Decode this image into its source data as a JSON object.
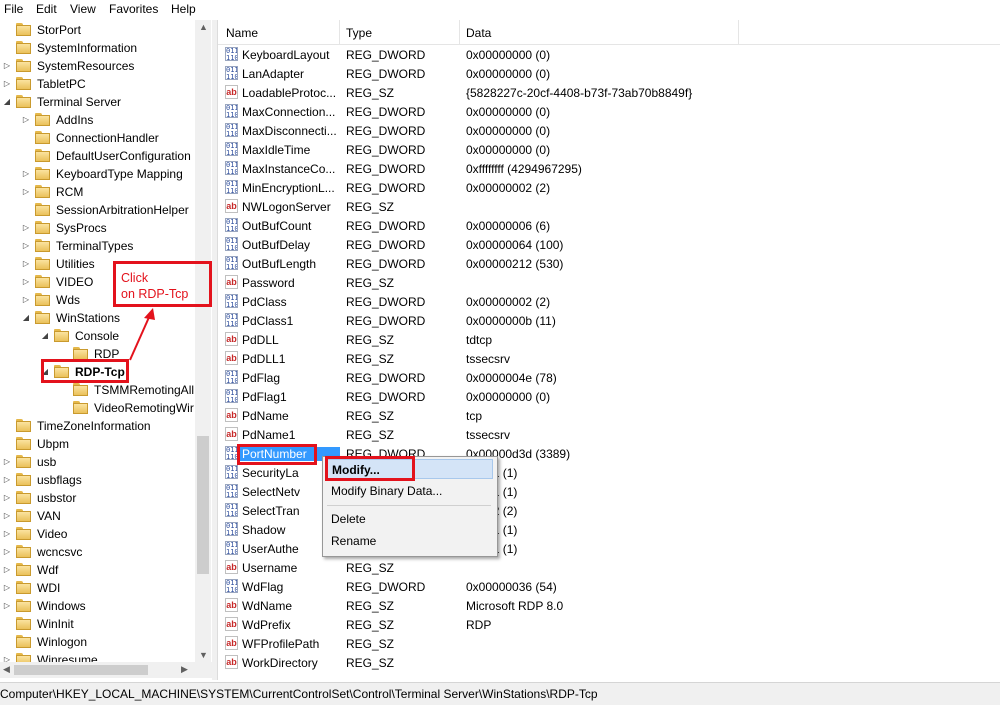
{
  "menubar": {
    "items": [
      "File",
      "Edit",
      "View",
      "Favorites",
      "Help"
    ]
  },
  "tree": {
    "items": [
      {
        "label": "StorPort"
      },
      {
        "label": "SystemInformation"
      },
      {
        "label": "SystemResources"
      },
      {
        "label": "TabletPC"
      },
      {
        "label": "Terminal Server"
      },
      {
        "label": "AddIns"
      },
      {
        "label": "ConnectionHandler"
      },
      {
        "label": "DefaultUserConfiguration"
      },
      {
        "label": "KeyboardType Mapping"
      },
      {
        "label": "RCM"
      },
      {
        "label": "SessionArbitrationHelper"
      },
      {
        "label": "SysProcs"
      },
      {
        "label": "TerminalTypes"
      },
      {
        "label": "Utilities"
      },
      {
        "label": "VIDEO"
      },
      {
        "label": "Wds"
      },
      {
        "label": "WinStations"
      },
      {
        "label": "Console"
      },
      {
        "label": "RDP"
      },
      {
        "label": "RDP-Tcp"
      },
      {
        "label": "TSMMRemotingAll"
      },
      {
        "label": "VideoRemotingWir"
      },
      {
        "label": "TimeZoneInformation"
      },
      {
        "label": "Ubpm"
      },
      {
        "label": "usb"
      },
      {
        "label": "usbflags"
      },
      {
        "label": "usbstor"
      },
      {
        "label": "VAN"
      },
      {
        "label": "Video"
      },
      {
        "label": "wcncsvc"
      },
      {
        "label": "Wdf"
      },
      {
        "label": "WDI"
      },
      {
        "label": "Windows"
      },
      {
        "label": "WinInit"
      },
      {
        "label": "Winlogon"
      },
      {
        "label": "Winresume"
      }
    ]
  },
  "columns": {
    "name": "Name",
    "type": "Type",
    "data": "Data"
  },
  "values": [
    {
      "icon": "dword",
      "name": "KeyboardLayout",
      "type": "REG_DWORD",
      "data": "0x00000000 (0)"
    },
    {
      "icon": "dword",
      "name": "LanAdapter",
      "type": "REG_DWORD",
      "data": "0x00000000 (0)"
    },
    {
      "icon": "sz",
      "name": "LoadableProtoc...",
      "type": "REG_SZ",
      "data": "{5828227c-20cf-4408-b73f-73ab70b8849f}"
    },
    {
      "icon": "dword",
      "name": "MaxConnection...",
      "type": "REG_DWORD",
      "data": "0x00000000 (0)"
    },
    {
      "icon": "dword",
      "name": "MaxDisconnecti...",
      "type": "REG_DWORD",
      "data": "0x00000000 (0)"
    },
    {
      "icon": "dword",
      "name": "MaxIdleTime",
      "type": "REG_DWORD",
      "data": "0x00000000 (0)"
    },
    {
      "icon": "dword",
      "name": "MaxInstanceCo...",
      "type": "REG_DWORD",
      "data": "0xffffffff (4294967295)"
    },
    {
      "icon": "dword",
      "name": "MinEncryptionL...",
      "type": "REG_DWORD",
      "data": "0x00000002 (2)"
    },
    {
      "icon": "sz",
      "name": "NWLogonServer",
      "type": "REG_SZ",
      "data": ""
    },
    {
      "icon": "dword",
      "name": "OutBufCount",
      "type": "REG_DWORD",
      "data": "0x00000006 (6)"
    },
    {
      "icon": "dword",
      "name": "OutBufDelay",
      "type": "REG_DWORD",
      "data": "0x00000064 (100)"
    },
    {
      "icon": "dword",
      "name": "OutBufLength",
      "type": "REG_DWORD",
      "data": "0x00000212 (530)"
    },
    {
      "icon": "sz",
      "name": "Password",
      "type": "REG_SZ",
      "data": ""
    },
    {
      "icon": "dword",
      "name": "PdClass",
      "type": "REG_DWORD",
      "data": "0x00000002 (2)"
    },
    {
      "icon": "dword",
      "name": "PdClass1",
      "type": "REG_DWORD",
      "data": "0x0000000b (11)"
    },
    {
      "icon": "sz",
      "name": "PdDLL",
      "type": "REG_SZ",
      "data": "tdtcp"
    },
    {
      "icon": "sz",
      "name": "PdDLL1",
      "type": "REG_SZ",
      "data": "tssecsrv"
    },
    {
      "icon": "dword",
      "name": "PdFlag",
      "type": "REG_DWORD",
      "data": "0x0000004e (78)"
    },
    {
      "icon": "dword",
      "name": "PdFlag1",
      "type": "REG_DWORD",
      "data": "0x00000000 (0)"
    },
    {
      "icon": "sz",
      "name": "PdName",
      "type": "REG_SZ",
      "data": "tcp"
    },
    {
      "icon": "sz",
      "name": "PdName1",
      "type": "REG_SZ",
      "data": "tssecsrv"
    },
    {
      "icon": "dword",
      "name": "PortNumber",
      "type": "REG_DWORD",
      "data": "0x00000d3d (3389)",
      "selected": true
    },
    {
      "icon": "dword",
      "name": "SecurityLa",
      "type": "",
      "data": "00001 (1)"
    },
    {
      "icon": "dword",
      "name": "SelectNetv",
      "type": "",
      "data": "00001 (1)"
    },
    {
      "icon": "dword",
      "name": "SelectTran",
      "type": "",
      "data": "00002 (2)"
    },
    {
      "icon": "dword",
      "name": "Shadow",
      "type": "",
      "data": "00001 (1)"
    },
    {
      "icon": "dword",
      "name": "UserAuthe",
      "type": "",
      "data": "00001 (1)"
    },
    {
      "icon": "sz",
      "name": "Username",
      "type": "REG_SZ",
      "data": ""
    },
    {
      "icon": "dword",
      "name": "WdFlag",
      "type": "REG_DWORD",
      "data": "0x00000036 (54)"
    },
    {
      "icon": "sz",
      "name": "WdName",
      "type": "REG_SZ",
      "data": "Microsoft RDP 8.0"
    },
    {
      "icon": "sz",
      "name": "WdPrefix",
      "type": "REG_SZ",
      "data": "RDP"
    },
    {
      "icon": "sz",
      "name": "WFProfilePath",
      "type": "REG_SZ",
      "data": ""
    },
    {
      "icon": "sz",
      "name": "WorkDirectory",
      "type": "REG_SZ",
      "data": ""
    }
  ],
  "context_menu": {
    "modify": "Modify...",
    "modify_binary": "Modify Binary Data...",
    "delete": "Delete",
    "rename": "Rename"
  },
  "annotation": {
    "line1": "Click",
    "line2": "on RDP-Tcp"
  },
  "statusbar": {
    "path": "Computer\\HKEY_LOCAL_MACHINE\\SYSTEM\\CurrentControlSet\\Control\\Terminal Server\\WinStations\\RDP-Tcp"
  },
  "colors": {
    "annotation_red": "#e3121c",
    "selection_blue": "#3399ff",
    "folder_yellow": "#f3d27a"
  }
}
